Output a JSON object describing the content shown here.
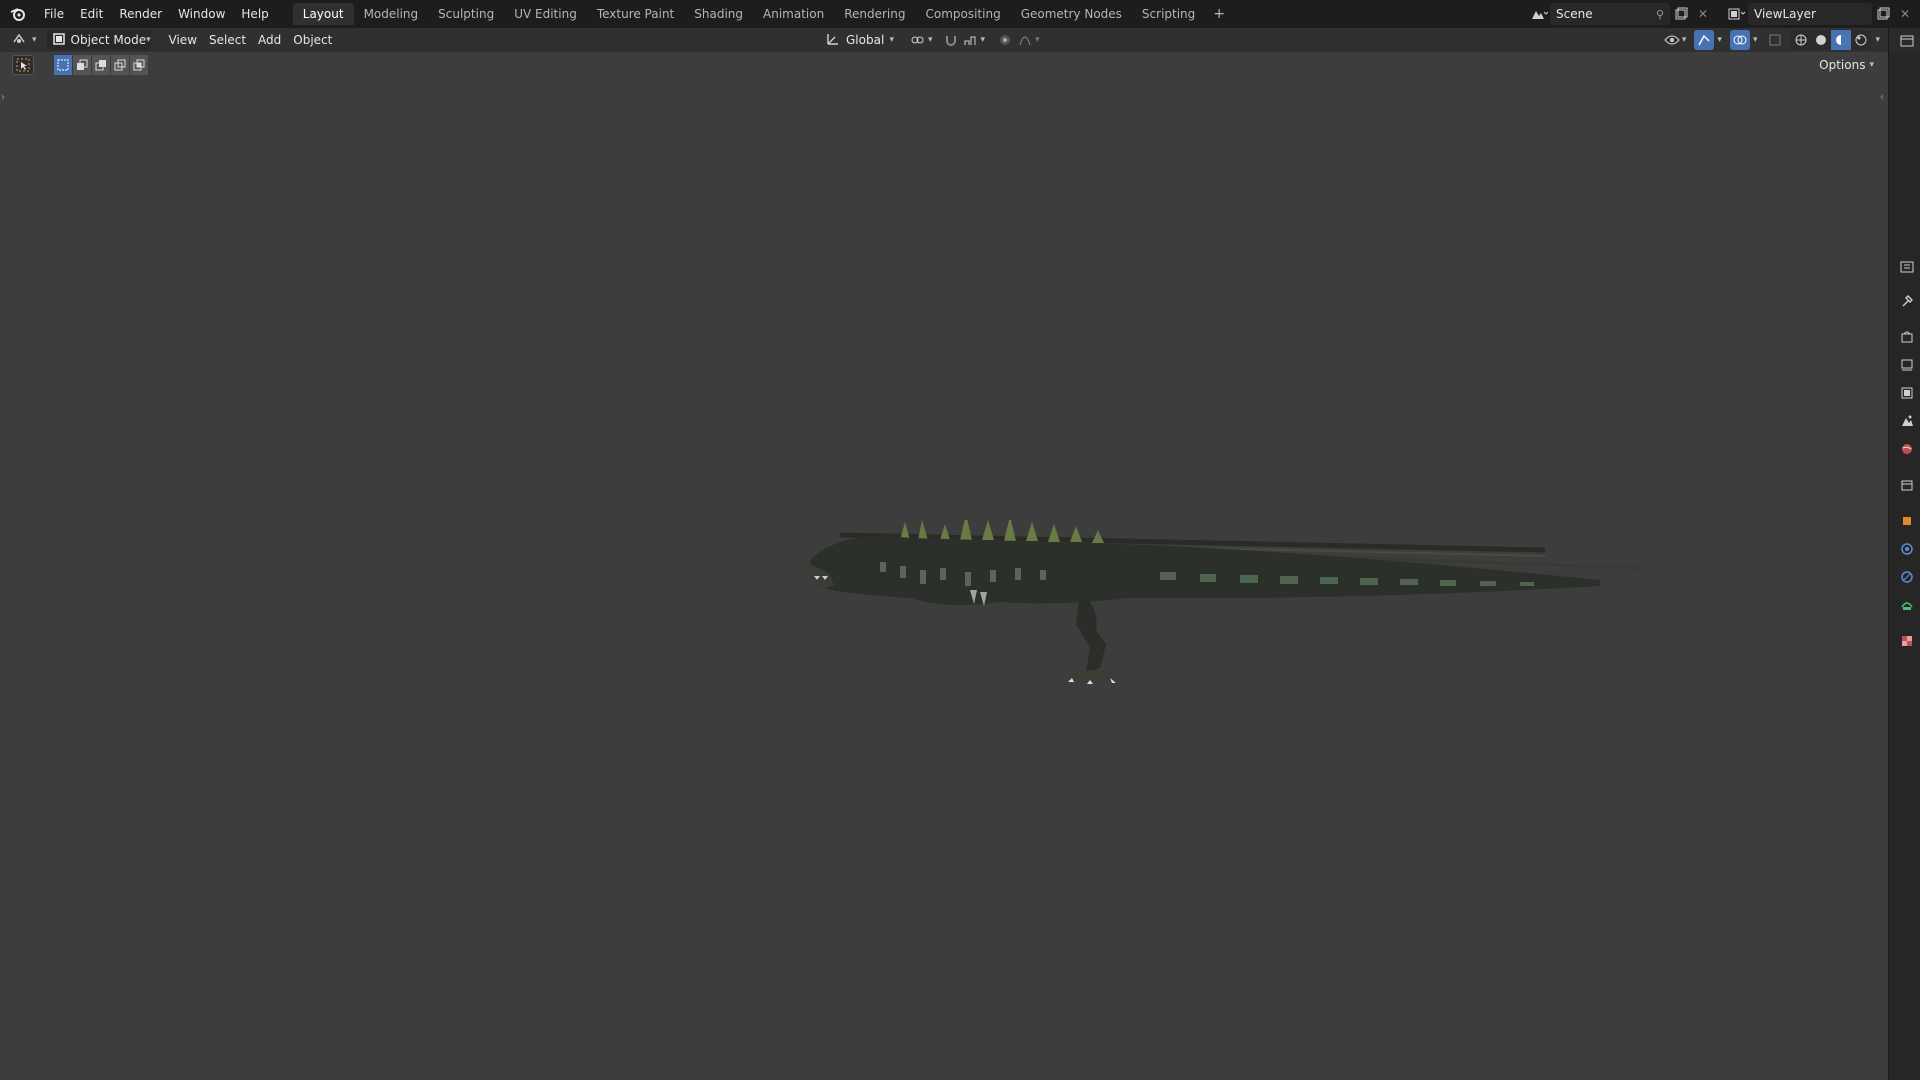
{
  "top_menu": {
    "items": [
      "File",
      "Edit",
      "Render",
      "Window",
      "Help"
    ]
  },
  "workspaces": {
    "tabs": [
      "Layout",
      "Modeling",
      "Sculpting",
      "UV Editing",
      "Texture Paint",
      "Shading",
      "Animation",
      "Rendering",
      "Compositing",
      "Geometry Nodes",
      "Scripting"
    ],
    "active": "Layout",
    "add_label": "+"
  },
  "scene": {
    "name": "Scene"
  },
  "view_layer": {
    "name": "ViewLayer"
  },
  "header": {
    "mode": "Object Mode",
    "menus": [
      "View",
      "Select",
      "Add",
      "Object"
    ],
    "transform_orientation": "Global"
  },
  "toolbar": {
    "options_label": "Options"
  },
  "colors": {
    "accent": "#4772b3",
    "background": "#3d3d3d",
    "topbar": "#1d1d1d",
    "header": "#303030"
  },
  "properties_tabs": [
    "tool-icon",
    "render-icon",
    "output-icon",
    "view-layer-icon",
    "scene-icon",
    "world-icon",
    "collection-icon",
    "object-icon",
    "modifier-icon",
    "physics-icon",
    "constraints-icon",
    "data-icon",
    "texture-icon"
  ]
}
